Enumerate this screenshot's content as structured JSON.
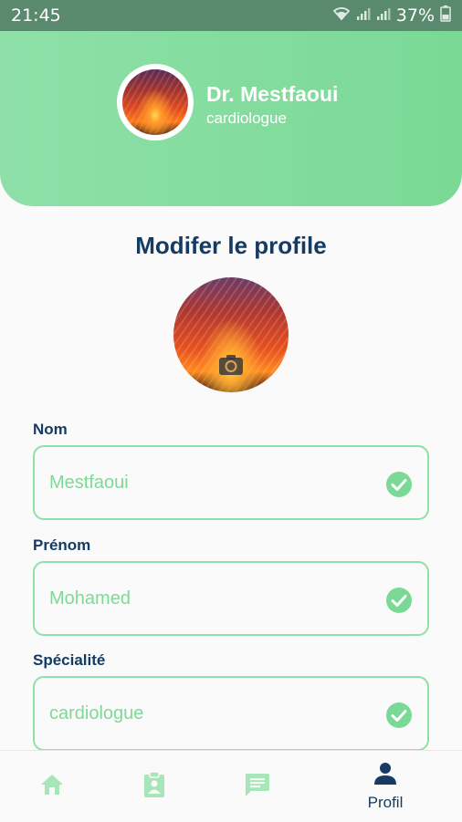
{
  "status": {
    "time": "21:45",
    "battery": "37%",
    "icons": [
      "wifi-icon",
      "signal-icon",
      "signal-icon",
      "battery-icon"
    ]
  },
  "header": {
    "name": "Dr. Mestfaoui",
    "role": "cardiologue"
  },
  "page": {
    "title": "Modifer le profile"
  },
  "form": {
    "fields": [
      {
        "label": "Nom",
        "value": "Mestfaoui",
        "icon": "check-circle-icon"
      },
      {
        "label": "Prénom",
        "value": "Mohamed",
        "icon": "check-circle-icon"
      },
      {
        "label": "Spécialité",
        "value": "cardiologue",
        "icon": "check-circle-icon"
      }
    ]
  },
  "nav": {
    "items": [
      {
        "icon": "home-icon",
        "label": ""
      },
      {
        "icon": "clipboard-icon",
        "label": ""
      },
      {
        "icon": "chat-icon",
        "label": ""
      },
      {
        "icon": "person-icon",
        "label": "Profil"
      }
    ]
  },
  "colors": {
    "accent": "#7ad995",
    "title": "#163b63",
    "status_bar": "#5a8a6e"
  }
}
